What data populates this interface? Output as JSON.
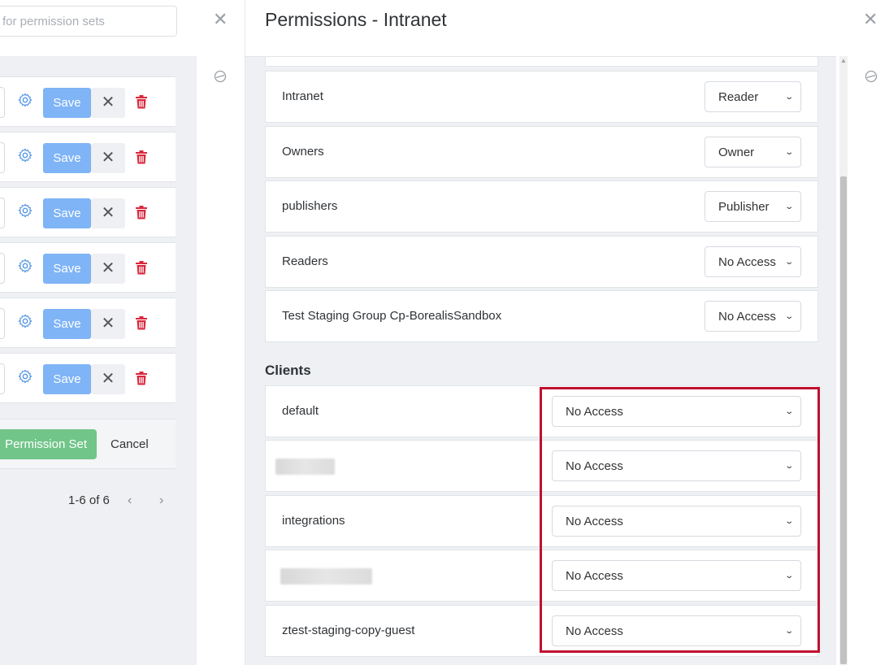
{
  "left_panel": {
    "search_placeholder": "for permission sets",
    "rows": [
      {
        "save_label": "Save"
      },
      {
        "save_label": "Save"
      },
      {
        "save_label": "Save"
      },
      {
        "save_label": "Save"
      },
      {
        "save_label": "Save"
      },
      {
        "save_label": "Save"
      }
    ],
    "add_button_label": "Permission Set",
    "cancel_label": "Cancel",
    "pagination": "1-6 of 6"
  },
  "modal": {
    "title": "Permissions - Intranet",
    "groups": [
      {
        "name": "Intranet",
        "permission": "Reader"
      },
      {
        "name": "Owners",
        "permission": "Owner"
      },
      {
        "name": "publishers",
        "permission": "Publisher"
      },
      {
        "name": "Readers",
        "permission": "No Access"
      },
      {
        "name": "Test Staging Group Cp-BorealisSandbox",
        "permission": "No Access"
      }
    ],
    "clients_heading": "Clients",
    "clients": [
      {
        "name": "default",
        "permission": "No Access",
        "redacted": false
      },
      {
        "name": "",
        "permission": "No Access",
        "redacted": true
      },
      {
        "name": "integrations",
        "permission": "No Access",
        "redacted": false
      },
      {
        "name": "",
        "permission": "No Access",
        "redacted": true
      },
      {
        "name": "ztest-staging-copy-guest",
        "permission": "No Access",
        "redacted": false
      }
    ]
  },
  "colors": {
    "save_button": "#7fb4f6",
    "add_button": "#71c589",
    "delete_icon": "#d9283d",
    "gear_icon": "#4a90e2",
    "highlight": "#c0102e"
  },
  "icons": [
    "close-icon",
    "gear-icon",
    "trash-icon",
    "chevron-down-icon",
    "chevron-left-icon",
    "chevron-right-icon",
    "collapse-icon"
  ]
}
